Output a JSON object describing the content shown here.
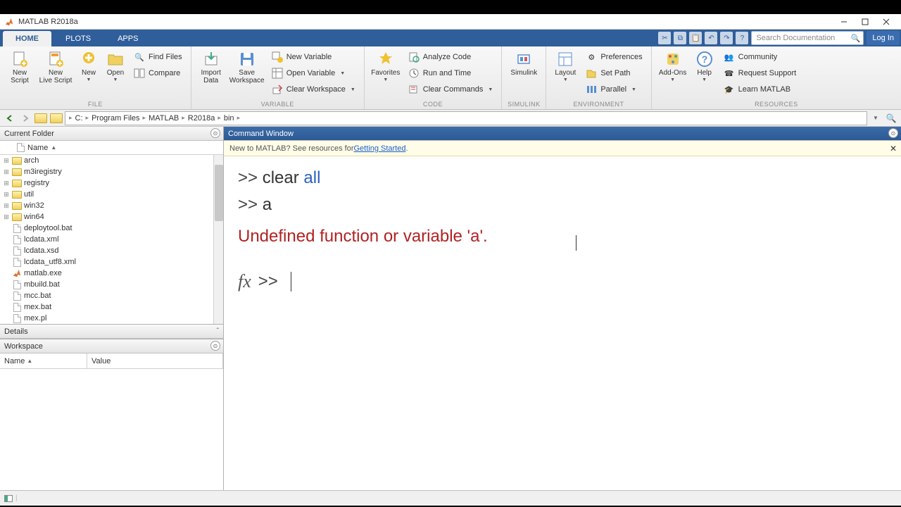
{
  "window": {
    "title": "MATLAB R2018a"
  },
  "tabs": {
    "home": "HOME",
    "plots": "PLOTS",
    "apps": "APPS"
  },
  "search": {
    "placeholder": "Search Documentation",
    "login": "Log In"
  },
  "toolstrip": {
    "file": {
      "label": "FILE",
      "new_script": "New\nScript",
      "new_livescript": "New\nLive Script",
      "new": "New",
      "open": "Open",
      "find_files": "Find Files",
      "compare": "Compare"
    },
    "variable": {
      "label": "VARIABLE",
      "import": "Import\nData",
      "save_ws": "Save\nWorkspace",
      "new_var": "New Variable",
      "open_var": "Open Variable",
      "clear_ws": "Clear Workspace"
    },
    "code": {
      "label": "CODE",
      "favorites": "Favorites",
      "analyze": "Analyze Code",
      "runtime": "Run and Time",
      "clear_cmd": "Clear Commands"
    },
    "simulink": {
      "label": "SIMULINK",
      "btn": "Simulink"
    },
    "environment": {
      "label": "ENVIRONMENT",
      "layout": "Layout",
      "prefs": "Preferences",
      "setpath": "Set Path",
      "parallel": "Parallel"
    },
    "resources": {
      "label": "RESOURCES",
      "addons": "Add-Ons",
      "help": "Help",
      "community": "Community",
      "support": "Request Support",
      "learn": "Learn MATLAB"
    }
  },
  "path": {
    "segs": [
      "C:",
      "Program Files",
      "MATLAB",
      "R2018a",
      "bin"
    ]
  },
  "current_folder": {
    "title": "Current Folder",
    "name_col": "Name",
    "items": [
      {
        "n": "arch",
        "d": true
      },
      {
        "n": "m3iregistry",
        "d": true
      },
      {
        "n": "registry",
        "d": true
      },
      {
        "n": "util",
        "d": true
      },
      {
        "n": "win32",
        "d": true
      },
      {
        "n": "win64",
        "d": true
      },
      {
        "n": "deploytool.bat",
        "d": false
      },
      {
        "n": "lcdata.xml",
        "d": false
      },
      {
        "n": "lcdata.xsd",
        "d": false
      },
      {
        "n": "lcdata_utf8.xml",
        "d": false
      },
      {
        "n": "matlab.exe",
        "d": false,
        "ml": true
      },
      {
        "n": "mbuild.bat",
        "d": false
      },
      {
        "n": "mcc.bat",
        "d": false
      },
      {
        "n": "mex.bat",
        "d": false
      },
      {
        "n": "mex.pl",
        "d": false
      }
    ]
  },
  "details": {
    "title": "Details"
  },
  "workspace": {
    "title": "Workspace",
    "name_col": "Name",
    "value_col": "Value"
  },
  "command": {
    "title": "Command Window",
    "info_pre": "New to MATLAB? See resources for ",
    "info_link": "Getting Started",
    "line1_prompt": ">> ",
    "line1_cmd": "clear ",
    "line1_kw": "all",
    "line2_prompt": ">> ",
    "line2_cmd": "a",
    "error": "Undefined function or variable 'a'.",
    "line3_prompt": ">> "
  }
}
